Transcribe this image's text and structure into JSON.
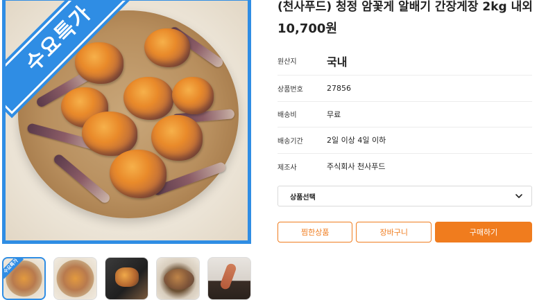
{
  "product": {
    "title": "(천사푸드) 청정 암꽃게 알배기 간장게장 2kg 내외",
    "price": "10,700원",
    "promo_badge": "수요특가",
    "thumb_badge": "수요특가"
  },
  "details": [
    {
      "label": "원산지",
      "value": "국내"
    },
    {
      "label": "상품번호",
      "value": "27856"
    },
    {
      "label": "배송비",
      "value": "무료"
    },
    {
      "label": "배송기간",
      "value": "2일 이상 4일 이하"
    },
    {
      "label": "제조사",
      "value": "주식회사 천사푸드"
    }
  ],
  "option_select": {
    "selected": "상품선택"
  },
  "buttons": {
    "wishlist": "찜한상품",
    "cart": "장바구니",
    "buy": "구매하기"
  },
  "colors": {
    "accent_blue": "#2f8de4",
    "accent_orange": "#f07c1e"
  }
}
